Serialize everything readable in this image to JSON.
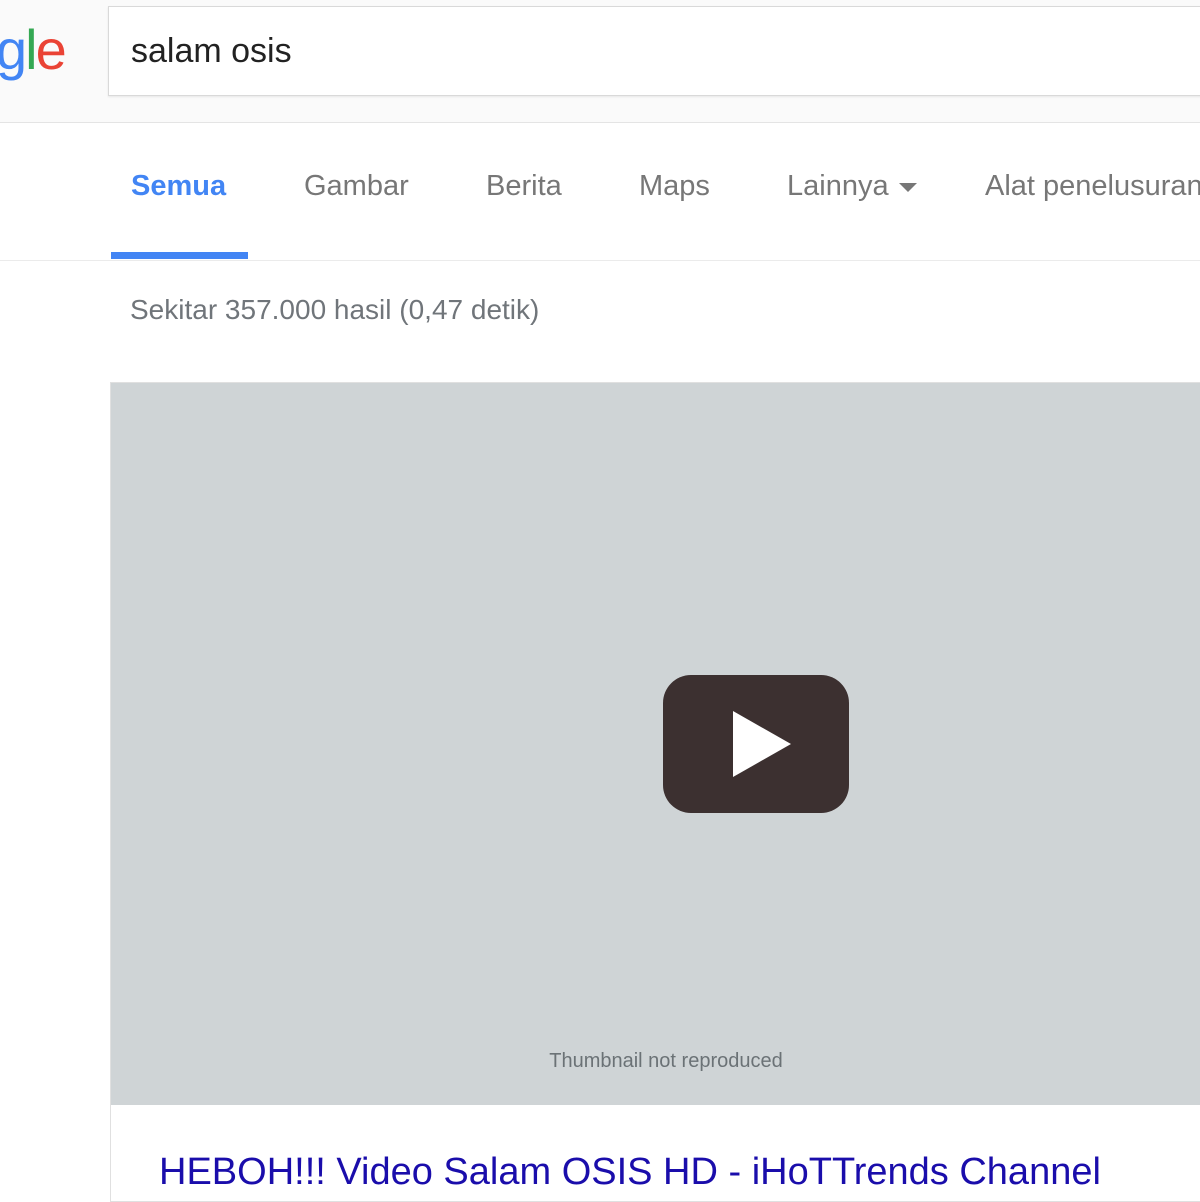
{
  "header": {
    "logo_partial": "gle",
    "search": {
      "value": "salam osis"
    }
  },
  "tabs": [
    {
      "label": "Semua",
      "active": true
    },
    {
      "label": "Gambar",
      "active": false
    },
    {
      "label": "Berita",
      "active": false
    },
    {
      "label": "Maps",
      "active": false
    },
    {
      "label": "Lainnya",
      "active": false
    },
    {
      "label": "Alat penelusuran",
      "active": false
    }
  ],
  "result_stats": "Sekitar 357.000 hasil (0,47 detik)",
  "video_result": {
    "title": "HEBOH!!! Video Salam OSIS HD - iHoTTrends Channel",
    "thumbnail_note": "Thumbnail not reproduced"
  },
  "colors": {
    "accent": "#4285f4",
    "link": "#1a0dab",
    "tab_inactive": "#777777"
  }
}
